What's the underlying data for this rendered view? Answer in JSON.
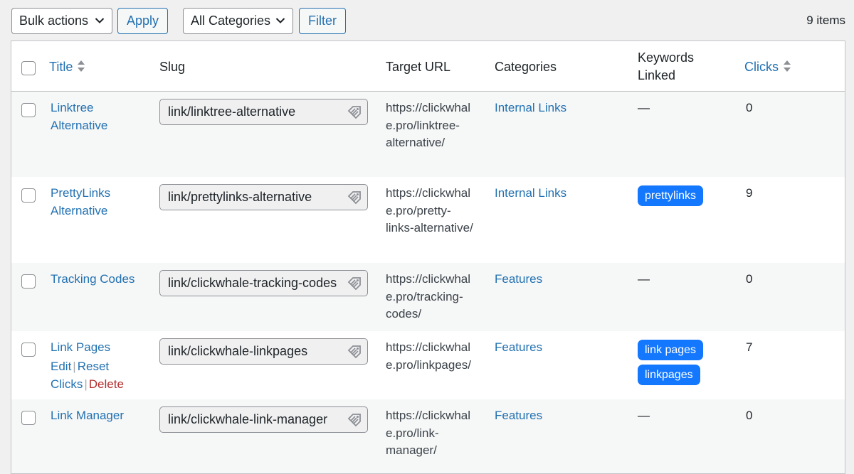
{
  "toolbar": {
    "bulk_actions": "Bulk actions",
    "apply": "Apply",
    "categories": "All Categories",
    "filter": "Filter",
    "item_count": "9 items"
  },
  "columns": {
    "title": "Title",
    "slug": "Slug",
    "target_url": "Target URL",
    "categories": "Categories",
    "keywords_line1": "Keywords",
    "keywords_line2": "Linked",
    "clicks": "Clicks"
  },
  "row_actions": {
    "edit": "Edit",
    "reset": "Reset",
    "clicks": "Clicks",
    "delete": "Delete"
  },
  "rows": [
    {
      "title_lines": [
        "Linktree",
        "Alternative"
      ],
      "slug": "link/linktree-alternative",
      "url_lines": [
        "https://clickwhal",
        "e.pro/linktree-",
        "alternative/"
      ],
      "category": "Internal Links",
      "keywords": [],
      "keywords_empty": "—",
      "clicks": "0"
    },
    {
      "title_lines": [
        "PrettyLinks",
        "Alternative"
      ],
      "slug": "link/prettylinks-alternative",
      "url_lines": [
        "https://clickwhal",
        "e.pro/pretty-",
        "links-alternative/"
      ],
      "category": "Internal Links",
      "keywords": [
        "prettylinks"
      ],
      "keywords_empty": "",
      "clicks": "9"
    },
    {
      "title_lines": [
        "Tracking Codes"
      ],
      "slug": "link/clickwhale-tracking-codes",
      "url_lines": [
        "https://clickwhal",
        "e.pro/tracking-",
        "codes/"
      ],
      "category": "Features",
      "keywords": [],
      "keywords_empty": "—",
      "clicks": "0"
    },
    {
      "title_lines": [
        "Link Pages"
      ],
      "slug": "link/clickwhale-linkpages",
      "url_lines": [
        "https://clickwhal",
        "e.pro/linkpages/"
      ],
      "category": "Features",
      "keywords": [
        "link pages",
        "linkpages"
      ],
      "keywords_empty": "",
      "clicks": "7"
    },
    {
      "title_lines": [
        "Link Manager"
      ],
      "slug": "link/clickwhale-link-manager",
      "url_lines": [
        "https://clickwhal",
        "e.pro/link-",
        "manager/"
      ],
      "category": "Features",
      "keywords": [],
      "keywords_empty": "—",
      "clicks": "0"
    }
  ]
}
